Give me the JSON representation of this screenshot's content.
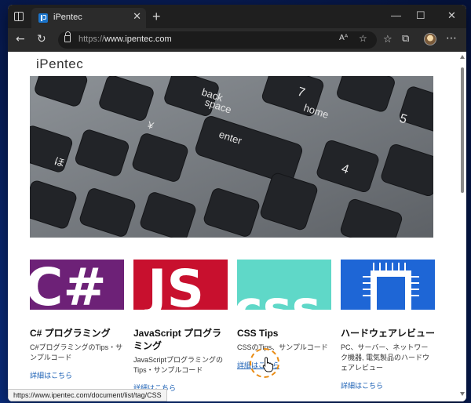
{
  "browser": {
    "tab_title": "iPentec",
    "close_tab_glyph": "✕",
    "new_tab_glyph": "+",
    "window_controls": {
      "minimize": "—",
      "maximize": "☐",
      "close": "✕"
    },
    "url_scheme": "https://",
    "url_host": "www.ipentec.com",
    "read_aloud_glyph": "Aᴬ",
    "more_glyph": "⋯"
  },
  "page": {
    "logo": "iPentec",
    "hero_image": "keyboard-closeup",
    "cards": [
      {
        "title": "C# プログラミング",
        "desc": "C#プログラミングのTips・サンプルコード",
        "link": "詳細はこちら",
        "thumb": "csharp",
        "color": "#6d2177"
      },
      {
        "title": "JavaScript プログラミング",
        "desc": "JavaScriptプログラミングのTips・サンプルコード",
        "link": "詳細はこちら",
        "thumb": "js",
        "color": "#c8102e"
      },
      {
        "title": "CSS Tips",
        "desc": "CSSのTips、サンプルコード",
        "link": "詳細はこちら",
        "thumb": "css",
        "color": "#5fd8c8"
      },
      {
        "title": "ハードウェアレビュー",
        "desc": "PC、サーバー、ネットワーク機器, 電気製品のハードウェアレビュー",
        "link": "詳細はこちら",
        "thumb": "chip",
        "color": "#1e66d6"
      }
    ]
  },
  "status_bar": {
    "url": "https://www.ipentec.com/document/list/tag/CSS"
  },
  "colors": {
    "link": "#1a5fb4",
    "highlight": "#e98b12",
    "titlebar": "#1f1f1f",
    "toolbar": "#2b2b2b"
  }
}
